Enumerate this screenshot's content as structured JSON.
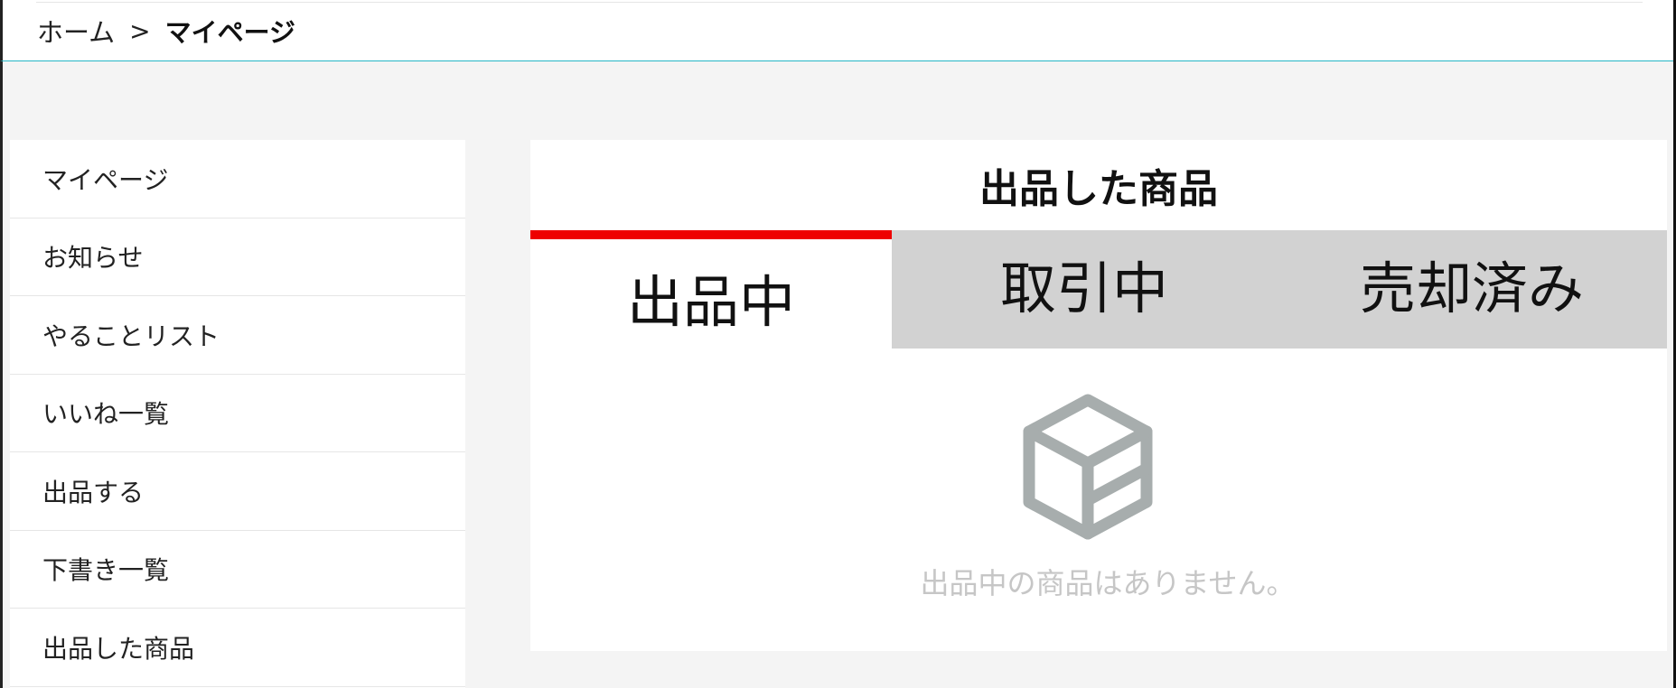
{
  "breadcrumb": {
    "home": "ホーム",
    "separator": ">",
    "current": "マイページ"
  },
  "sidebar": {
    "items": [
      {
        "label": "マイページ"
      },
      {
        "label": "お知らせ"
      },
      {
        "label": "やることリスト"
      },
      {
        "label": "いいね一覧"
      },
      {
        "label": "出品する"
      },
      {
        "label": "下書き一覧"
      },
      {
        "label": "出品した商品"
      }
    ]
  },
  "main": {
    "title": "出品した商品",
    "tabs": [
      {
        "label": "出品中",
        "active": true
      },
      {
        "label": "取引中",
        "active": false
      },
      {
        "label": "売却済み",
        "active": false
      }
    ],
    "empty_icon": "box-icon",
    "empty_message": "出品中の商品はありません。"
  },
  "colors": {
    "accent_tab": "#ee0000",
    "header_border": "#26b6c6",
    "inactive_tab": "#d2d2d2",
    "icon": "#a7adad"
  }
}
